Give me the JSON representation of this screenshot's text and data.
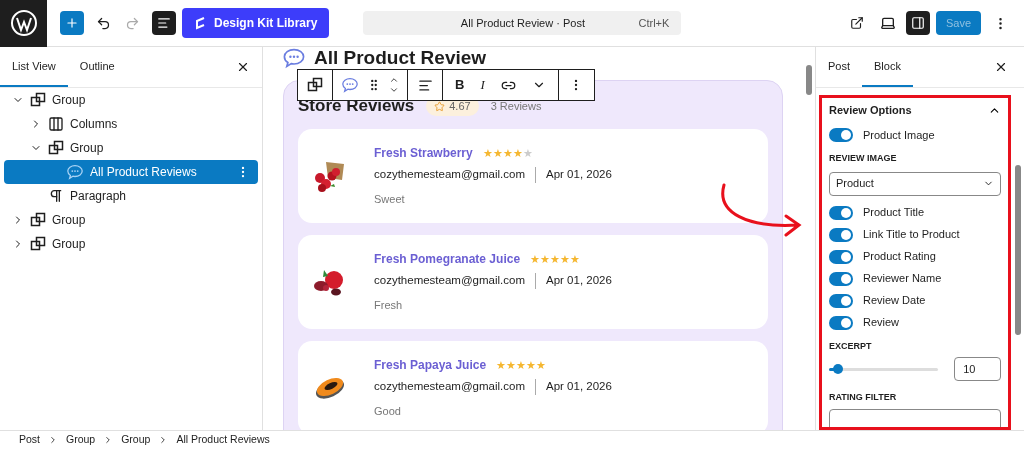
{
  "toolbar": {
    "library_button": "Design Kit Library",
    "command_bar": {
      "title": "All Product Review · Post",
      "shortcut": "Ctrl+K"
    },
    "save_button": {
      "label": "Save",
      "disabled": true
    },
    "sidebar_toggle": {
      "on": true
    }
  },
  "left_panel": {
    "tabs": [
      {
        "label": "List View",
        "selected": true
      },
      {
        "label": "Outline",
        "selected": false
      }
    ],
    "tree": [
      {
        "label": "Group",
        "kind": "group",
        "expanded": true,
        "selected": false,
        "children": [
          {
            "label": "Columns",
            "kind": "columns",
            "expanded": false,
            "selected": false
          },
          {
            "label": "Group",
            "kind": "group",
            "expanded": true,
            "selected": false,
            "children": [
              {
                "label": "All Product Reviews",
                "kind": "review",
                "selected": true
              }
            ]
          },
          {
            "label": "Paragraph",
            "kind": "paragraph",
            "selected": false
          }
        ]
      },
      {
        "label": "Group",
        "kind": "group",
        "expanded": false,
        "selected": false
      },
      {
        "label": "Group",
        "kind": "group",
        "expanded": false,
        "selected": false
      }
    ]
  },
  "canvas": {
    "page_title": "All Product Review",
    "block_toolbar": {
      "format_buttons": [
        "B",
        "I"
      ]
    },
    "store": {
      "title": "Store Reviews",
      "rating": "4.67",
      "count": "3 Reviews"
    },
    "reviews": [
      {
        "product": "Fresh Strawberry",
        "stars": 4,
        "email": "cozythemesteam@gmail.com",
        "date": "Apr 01, 2026",
        "text": "Sweet"
      },
      {
        "product": "Fresh Pomegranate Juice",
        "stars": 5,
        "email": "cozythemesteam@gmail.com",
        "date": "Apr 01, 2026",
        "text": "Fresh"
      },
      {
        "product": "Fresh Papaya Juice",
        "stars": 5,
        "email": "cozythemesteam@gmail.com",
        "date": "Apr 01, 2026",
        "text": "Good"
      }
    ]
  },
  "right_panel": {
    "tabs": [
      {
        "label": "Post",
        "selected": false
      },
      {
        "label": "Block",
        "selected": true
      }
    ],
    "section": {
      "title": "Review Options",
      "expanded": true
    },
    "toggles_top": [
      {
        "label": "Product Image",
        "on": true
      }
    ],
    "review_image": {
      "label": "REVIEW IMAGE",
      "value": "Product"
    },
    "toggles": [
      {
        "label": "Product Title",
        "on": true
      },
      {
        "label": "Link Title to Product",
        "on": true
      },
      {
        "label": "Product Rating",
        "on": true
      },
      {
        "label": "Reviewer Name",
        "on": true
      },
      {
        "label": "Review Date",
        "on": true
      },
      {
        "label": "Review",
        "on": true
      }
    ],
    "excerpt": {
      "label": "EXCERPT",
      "level": 0.08,
      "value": "10"
    },
    "rating_filter": {
      "label": "RATING FILTER"
    }
  },
  "breadcrumbs": [
    "Post",
    "Group",
    "Group",
    "All Product Reviews"
  ]
}
